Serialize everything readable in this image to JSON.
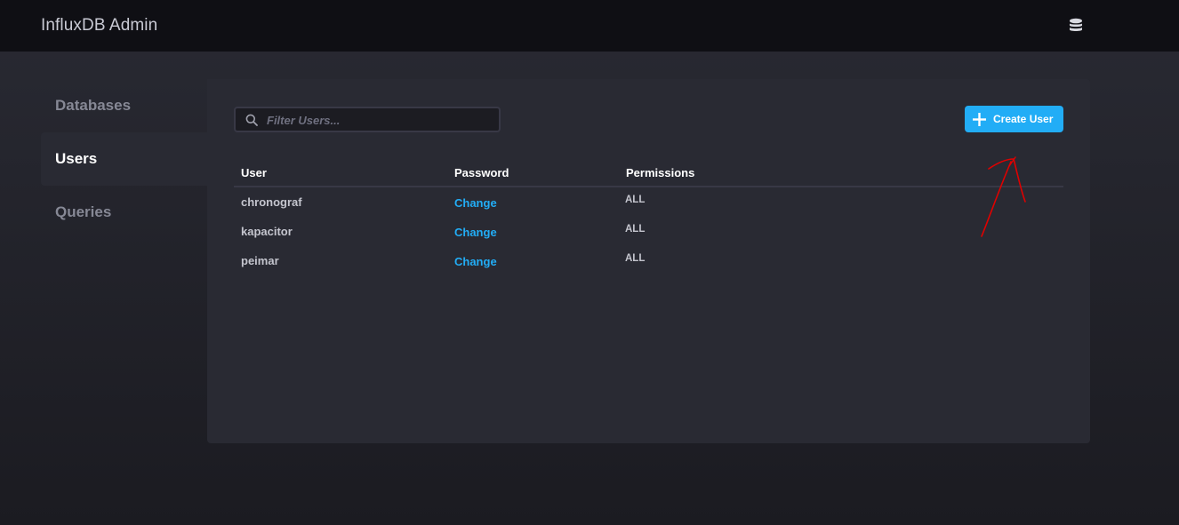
{
  "header": {
    "title": "InfluxDB Admin",
    "icon": "database-icon"
  },
  "sidebar": {
    "items": [
      {
        "label": "Databases",
        "active": false
      },
      {
        "label": "Users",
        "active": true
      },
      {
        "label": "Queries",
        "active": false
      }
    ]
  },
  "toolbar": {
    "filter_placeholder": "Filter Users...",
    "filter_value": "",
    "create_label": "Create User"
  },
  "table": {
    "columns": [
      "User",
      "Password",
      "Permissions"
    ],
    "rows": [
      {
        "user": "chronograf",
        "password": "Change",
        "permissions": "ALL"
      },
      {
        "user": "kapacitor",
        "password": "Change",
        "permissions": "ALL"
      },
      {
        "user": "peimar",
        "password": "Change",
        "permissions": "ALL"
      }
    ]
  },
  "colors": {
    "accent": "#22adf6",
    "annotation": "#e00000"
  }
}
